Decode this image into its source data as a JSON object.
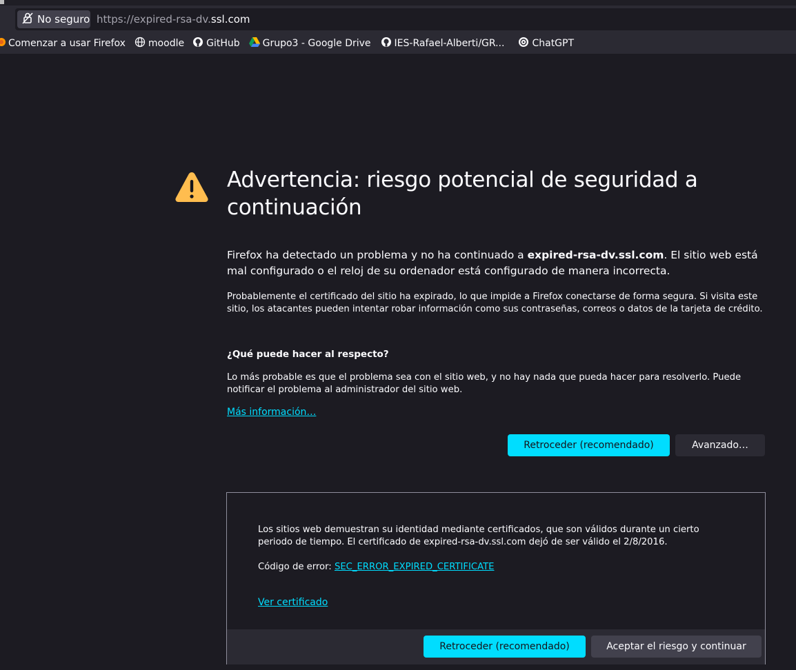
{
  "browser": {
    "security_label": "No seguro",
    "url_prefix": "https://expired-rsa-dv.",
    "url_host": "ssl.com"
  },
  "bookmarks": [
    {
      "label": "Comenzar a usar Firefox",
      "icon": "firefox-icon"
    },
    {
      "label": "moodle",
      "icon": "globe-icon"
    },
    {
      "label": "GitHub",
      "icon": "github-icon"
    },
    {
      "label": "Grupo3 - Google Drive",
      "icon": "google-drive-icon"
    },
    {
      "label": "IES-Rafael-Alberti/GR...",
      "icon": "github-icon"
    },
    {
      "label": "ChatGPT",
      "icon": "chatgpt-icon"
    }
  ],
  "error_page": {
    "title": "Advertencia: riesgo potencial de seguridad a continuación",
    "intro_before": "Firefox ha detectado un problema y no ha continuado a ",
    "intro_host": "expired-rsa-dv.ssl.com",
    "intro_after": ". El sitio web está mal configurado o el reloj de su ordenador está configurado de manera incorrecta.",
    "detail": "Probablemente el certificado del sitio ha expirado, lo que impide a Firefox conectarse de forma segura. Si visita este sitio, los atacantes pueden intentar robar información como sus contraseñas, correos o datos de la tarjeta de crédito.",
    "question": "¿Qué puede hacer al respecto?",
    "answer": "Lo más probable es que el problema sea con el sitio web, y no hay nada que pueda hacer para resolverlo. Puede notificar el problema al administrador del sitio web.",
    "more_info": "Más información…",
    "back_button": "Retroceder (recomendado)",
    "advanced_button": "Avanzado…"
  },
  "advanced": {
    "text": "Los sitios web demuestran su identidad mediante certificados, que son válidos durante un cierto periodo de tiempo. El certificado de expired-rsa-dv.ssl.com dejó de ser válido el 2/8/2016.",
    "error_code_label": "Código de error: ",
    "error_code": "SEC_ERROR_EXPIRED_CERTIFICATE",
    "view_certificate": "Ver certificado",
    "back_button": "Retroceder (recomendado)",
    "accept_button": "Aceptar el riesgo y continuar"
  },
  "colors": {
    "background": "#1c1b22",
    "accent": "#00ddff",
    "warning": "#ffbd4f"
  }
}
